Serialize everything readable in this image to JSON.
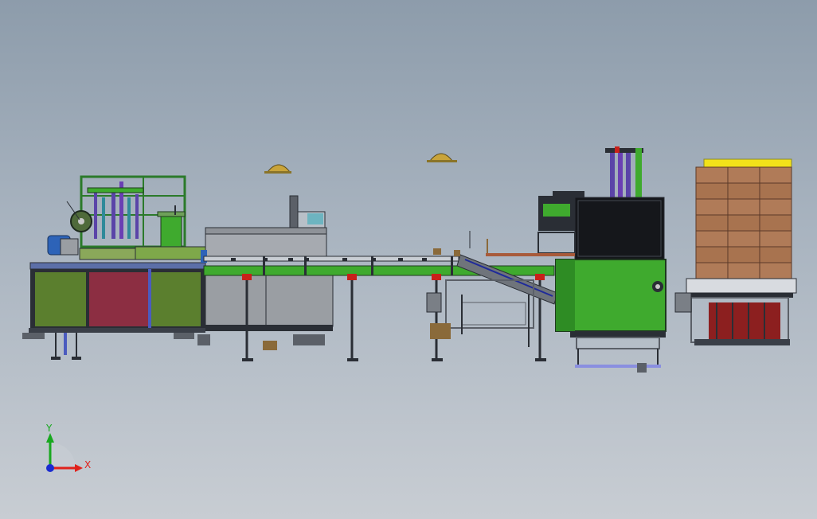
{
  "viewport": {
    "background_top": "#8d9cab",
    "background_bottom": "#c8cdd3"
  },
  "triad": {
    "x_label": "X",
    "y_label": "Y",
    "x_color": "#e0211b",
    "y_color": "#18a81f",
    "z_color": "#1a2bd0"
  },
  "colors": {
    "machine_green": "#3faa2e",
    "panel_dark_green": "#5b7f2e",
    "panel_maroon": "#8c2e42",
    "steel_grey": "#9a9ea3",
    "frame_dark": "#2a2e35",
    "purple": "#6a3fb3",
    "red_clamp": "#c8201a",
    "carton_brown": "#b07b58",
    "carton_yellow": "#f2e21a",
    "helmet_gold": "#c9a43a"
  },
  "icons": {
    "helmet_left": "helmet-icon",
    "helmet_right": "helmet-icon",
    "axis_triad": "coordinate-triad-icon"
  }
}
